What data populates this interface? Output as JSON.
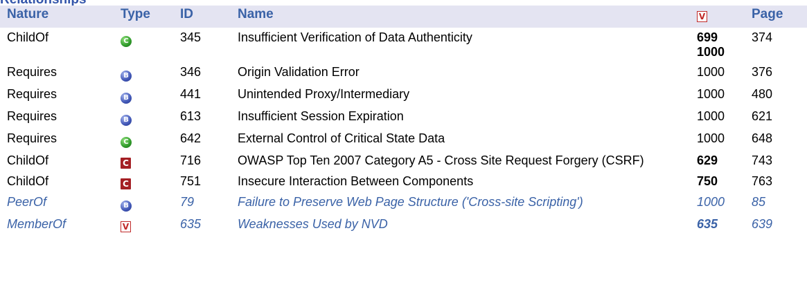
{
  "section_title": "Relationships",
  "columns": {
    "nature": "Nature",
    "type": "Type",
    "id": "ID",
    "name": "Name",
    "view_icon": "V",
    "page": "Page"
  },
  "icons": {
    "C_circle": {
      "name": "category-circle-green-icon",
      "glyph": "C",
      "color": "#2f9a2a"
    },
    "B_circle": {
      "name": "base-circle-blue-icon",
      "glyph": "B",
      "color": "#3f55b5"
    },
    "C_square": {
      "name": "category-square-red-icon",
      "glyph": "C",
      "color": "#a41f24"
    },
    "V_square": {
      "name": "view-square-icon",
      "glyph": "V",
      "color": "#c02a2a"
    }
  },
  "rows": [
    {
      "nature": "ChildOf",
      "type": "C_circle",
      "id": "345",
      "name": "Insufficient Verification of Data Authenticity",
      "views": [
        "699",
        "1000"
      ],
      "views_bold": true,
      "page": "374"
    },
    {
      "nature": "Requires",
      "type": "B_circle",
      "id": "346",
      "name": "Origin Validation Error",
      "views": [
        "1000"
      ],
      "views_bold": false,
      "page": "376"
    },
    {
      "nature": "Requires",
      "type": "B_circle",
      "id": "441",
      "name": "Unintended Proxy/Intermediary",
      "views": [
        "1000"
      ],
      "views_bold": false,
      "page": "480"
    },
    {
      "nature": "Requires",
      "type": "B_circle",
      "id": "613",
      "name": "Insufficient Session Expiration",
      "views": [
        "1000"
      ],
      "views_bold": false,
      "page": "621"
    },
    {
      "nature": "Requires",
      "type": "C_circle",
      "id": "642",
      "name": "External Control of Critical State Data",
      "views": [
        "1000"
      ],
      "views_bold": false,
      "page": "648"
    },
    {
      "nature": "ChildOf",
      "type": "C_square",
      "id": "716",
      "name": "OWASP Top Ten 2007 Category A5 - Cross Site Request Forgery (CSRF)",
      "views": [
        "629"
      ],
      "views_bold": true,
      "page": "743"
    },
    {
      "nature": "ChildOf",
      "type": "C_square",
      "id": "751",
      "name": "Insecure Interaction Between Components",
      "views": [
        "750"
      ],
      "views_bold": true,
      "page": "763"
    },
    {
      "nature": "PeerOf",
      "type": "B_circle",
      "id": "79",
      "name": "Failure to Preserve Web Page Structure ('Cross-site Scripting')",
      "views": [
        "1000"
      ],
      "views_bold": false,
      "page": "85",
      "italic": true
    },
    {
      "nature": "MemberOf",
      "type": "V_square",
      "id": "635",
      "name": "Weaknesses Used by NVD",
      "views": [
        "635"
      ],
      "views_bold": true,
      "page": "639",
      "italic": true
    }
  ]
}
